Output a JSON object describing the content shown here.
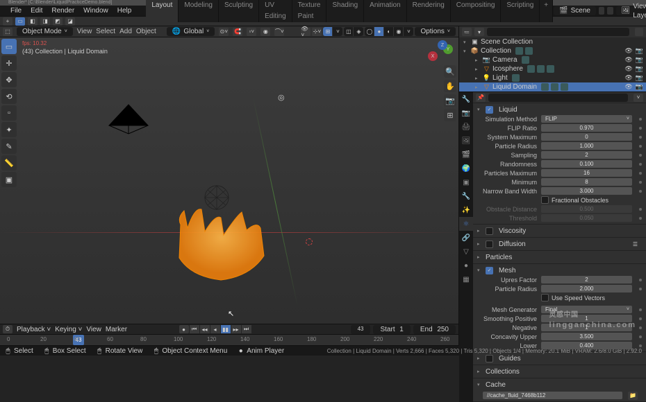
{
  "title": "Blender* [C:\\Blender\\LiquidPracticeDemo.blend]",
  "menu": {
    "file": "File",
    "edit": "Edit",
    "render": "Render",
    "window": "Window",
    "help": "Help"
  },
  "tabs": [
    "Layout",
    "Modeling",
    "Sculpting",
    "UV Editing",
    "Texture Paint",
    "Shading",
    "Animation",
    "Rendering",
    "Compositing",
    "Scripting"
  ],
  "active_tab": "Layout",
  "scene": {
    "scene_label": "Scene",
    "layer_label": "View Layer"
  },
  "viewport": {
    "mode": "Object Mode",
    "menus": {
      "view": "View",
      "select": "Select",
      "add": "Add",
      "object": "Object"
    },
    "orient": "Global",
    "options": "Options",
    "fps": "fps: 10.32",
    "active": "(43) Collection | Liquid Domain"
  },
  "outliner": {
    "header": "Scene Collection",
    "items": [
      {
        "name": "Collection",
        "icon": "📦",
        "color": "#e0e0e0",
        "chips": 2
      },
      {
        "name": "Camera",
        "icon": "📷",
        "color": "#e87d0d",
        "chips": 1
      },
      {
        "name": "Icosphere",
        "icon": "▽",
        "color": "#e87d0d",
        "chips": 3
      },
      {
        "name": "Light",
        "icon": "💡",
        "color": "#e87d0d",
        "chips": 1
      },
      {
        "name": "Liquid Domain",
        "icon": "▽",
        "color": "#e87d0d",
        "chips": 3,
        "selected": true
      }
    ]
  },
  "physics": {
    "liquid_label": "Liquid",
    "rows": [
      {
        "label": "Simulation Method",
        "value": "FLIP",
        "type": "dropdown"
      },
      {
        "label": "FLIP Ratio",
        "value": "0.970"
      },
      {
        "label": "System Maximum",
        "value": "0"
      },
      {
        "label": "Particle Radius",
        "value": "1.000"
      },
      {
        "label": "Sampling",
        "value": "2"
      },
      {
        "label": "Randomness",
        "value": "0.100"
      },
      {
        "label": "Particles Maximum",
        "value": "16"
      },
      {
        "label": "Minimum",
        "value": "8"
      },
      {
        "label": "Narrow Band Width",
        "value": "3.000"
      }
    ],
    "fractional": "Fractional Obstacles",
    "disabled_rows": [
      {
        "label": "Obstacle Distance",
        "value": "0.500"
      },
      {
        "label": "Threshold",
        "value": "0.050"
      }
    ],
    "viscosity": "Viscosity",
    "diffusion": "Diffusion",
    "particles": "Particles",
    "mesh": "Mesh",
    "mesh_rows": [
      {
        "label": "Upres Factor",
        "value": "2"
      },
      {
        "label": "Particle Radius",
        "value": "2.000"
      }
    ],
    "speed_vectors": "Use Speed Vectors",
    "gen_rows": [
      {
        "label": "Mesh Generator",
        "value": "Final",
        "type": "dropdown"
      },
      {
        "label": "Smoothing Positive",
        "value": "1"
      },
      {
        "label": "Negative",
        "value": "1"
      },
      {
        "label": "Concavity Upper",
        "value": "3.500"
      },
      {
        "label": "Lower",
        "value": "0.400"
      }
    ],
    "guides": "Guides",
    "collections": "Collections",
    "cache": "Cache",
    "cache_path": "//cache_fluid_7468b112"
  },
  "timeline": {
    "playback": "Playback",
    "keying": "Keying",
    "view": "View",
    "marker": "Marker",
    "current": "43",
    "start_label": "Start",
    "start": "1",
    "end_label": "End",
    "end": "250",
    "ticks": [
      "0",
      "20",
      "40",
      "60",
      "80",
      "100",
      "120",
      "140",
      "160",
      "180",
      "200",
      "220",
      "240",
      "260"
    ]
  },
  "status": {
    "select": "Select",
    "box": "Box Select",
    "rotate": "Rotate View",
    "ctx": "Object Context Menu",
    "anim": "Anim Player",
    "right": "Collection | Liquid Domain  |  Verts 2,666  |  Faces 5,320  |  Tris 5,320  |  Objects 1/4  |  Memory: 20.1 MiB  |  VRAM: 2.6/8.0 GiB  |  2.92.0"
  },
  "watermark": {
    "main": "灵感中国",
    "sub": "lingganchina.com"
  }
}
